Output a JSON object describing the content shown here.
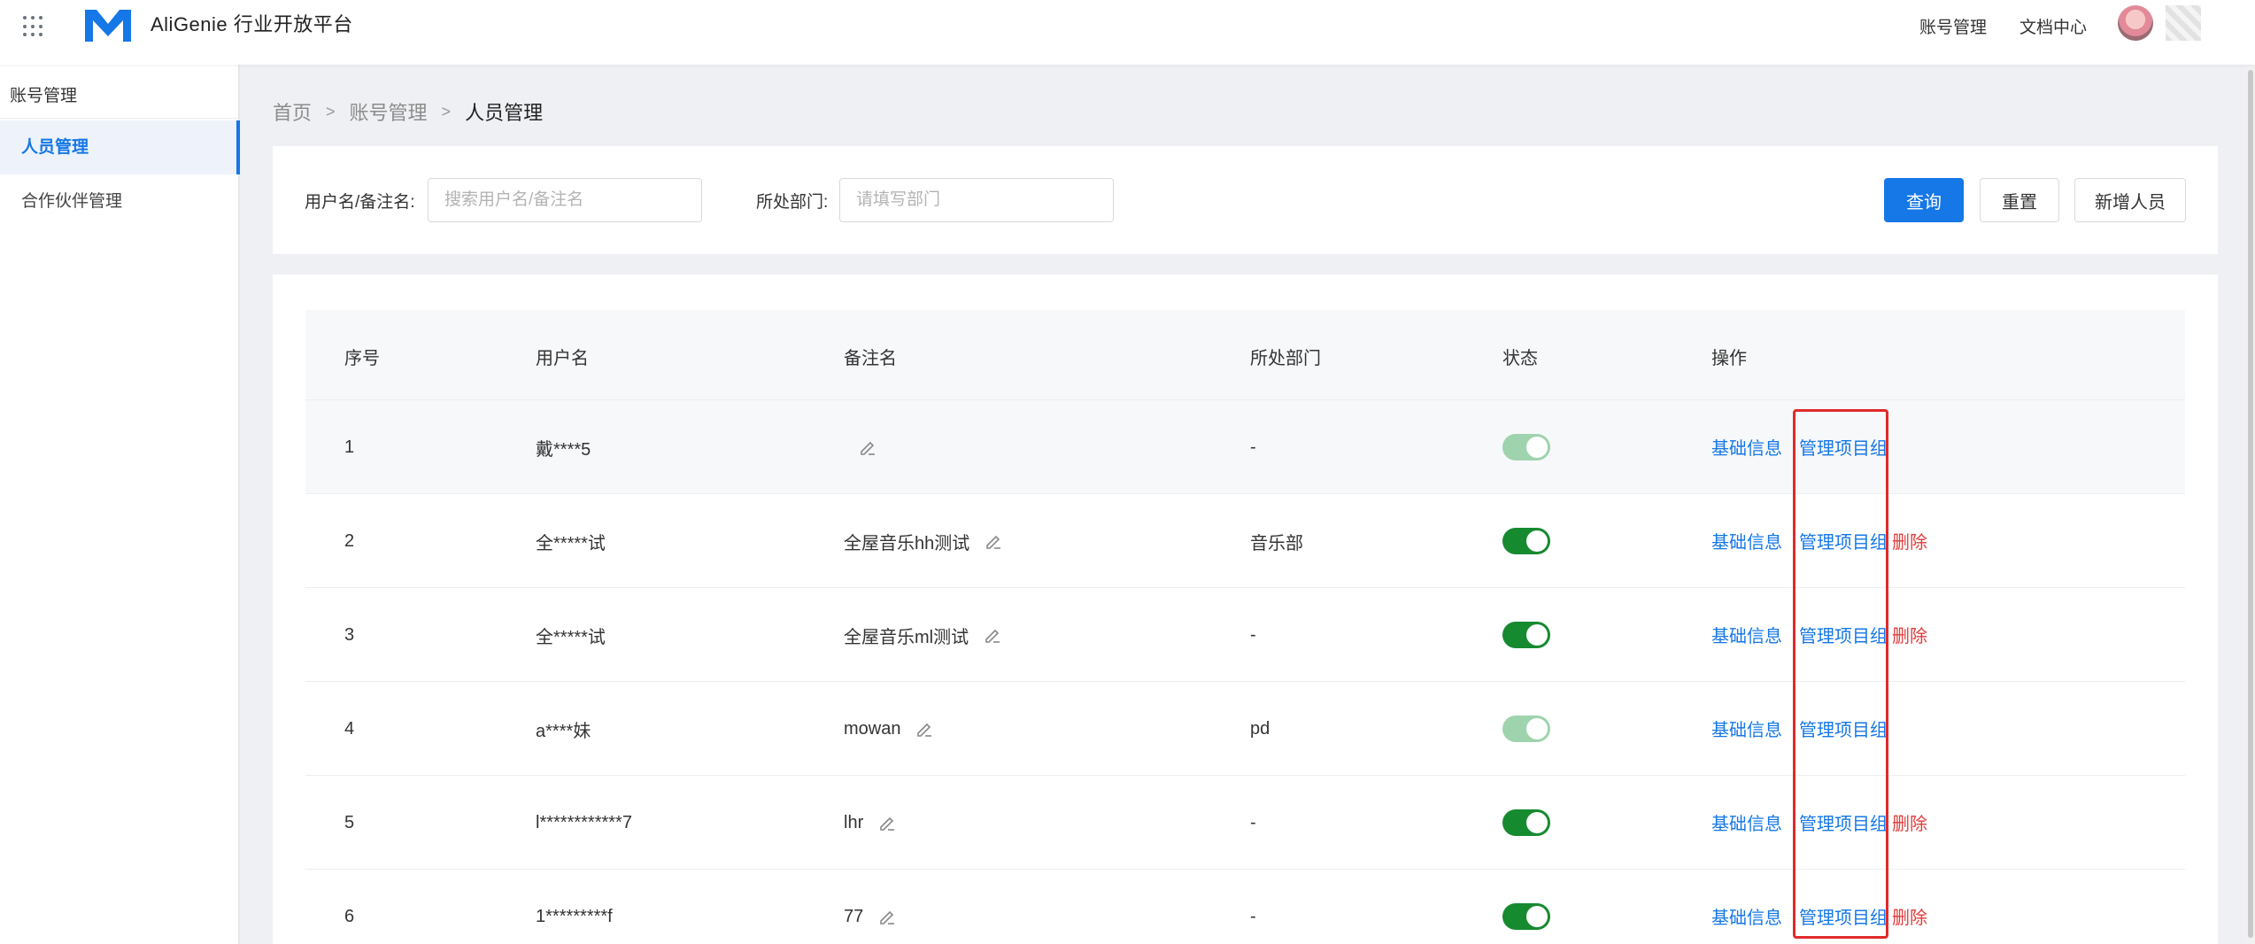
{
  "header": {
    "app_title": "AliGenie 行业开放平台",
    "links": [
      "账号管理",
      "文档中心"
    ]
  },
  "sidebar": {
    "group": "账号管理",
    "items": [
      {
        "label": "人员管理",
        "active": true
      },
      {
        "label": "合作伙伴管理",
        "active": false
      }
    ]
  },
  "breadcrumb": [
    "首页",
    "账号管理",
    "人员管理"
  ],
  "breadcrumb_sep": ">",
  "filter": {
    "username_label": "用户名/备注名:",
    "username_placeholder": "搜索用户名/备注名",
    "dept_label": "所处部门:",
    "dept_placeholder": "请填写部门",
    "query": "查询",
    "reset": "重置",
    "add": "新增人员"
  },
  "table": {
    "columns": [
      "序号",
      "用户名",
      "备注名",
      "所处部门",
      "状态",
      "操作"
    ],
    "rows": [
      {
        "index": "1",
        "username": "戴****5",
        "remark": "",
        "dept": "-",
        "status": "on-disabled",
        "ops": [
          "基础信息",
          "管理项目组"
        ]
      },
      {
        "index": "2",
        "username": "全*****试",
        "remark": "全屋音乐hh测试",
        "dept": "音乐部",
        "status": "on",
        "ops": [
          "基础信息",
          "管理项目组",
          "删除"
        ]
      },
      {
        "index": "3",
        "username": "全*****试",
        "remark": "全屋音乐ml测试",
        "dept": "-",
        "status": "on",
        "ops": [
          "基础信息",
          "管理项目组",
          "删除"
        ]
      },
      {
        "index": "4",
        "username": "a****妹",
        "remark": "mowan",
        "dept": "pd",
        "status": "on-disabled",
        "ops": [
          "基础信息",
          "管理项目组"
        ]
      },
      {
        "index": "5",
        "username": "l************7",
        "remark": "lhr",
        "dept": "-",
        "status": "on",
        "ops": [
          "基础信息",
          "管理项目组",
          "删除"
        ]
      },
      {
        "index": "6",
        "username": "1*********f",
        "remark": "77",
        "dept": "-",
        "status": "on",
        "ops": [
          "基础信息",
          "管理项目组",
          "删除"
        ]
      }
    ]
  },
  "colors": {
    "primary": "#1677e6",
    "danger": "#e23b3b",
    "switch_on": "#168a2f",
    "switch_on_disabled": "#9fd3ae",
    "highlight": "#e02a2a"
  }
}
